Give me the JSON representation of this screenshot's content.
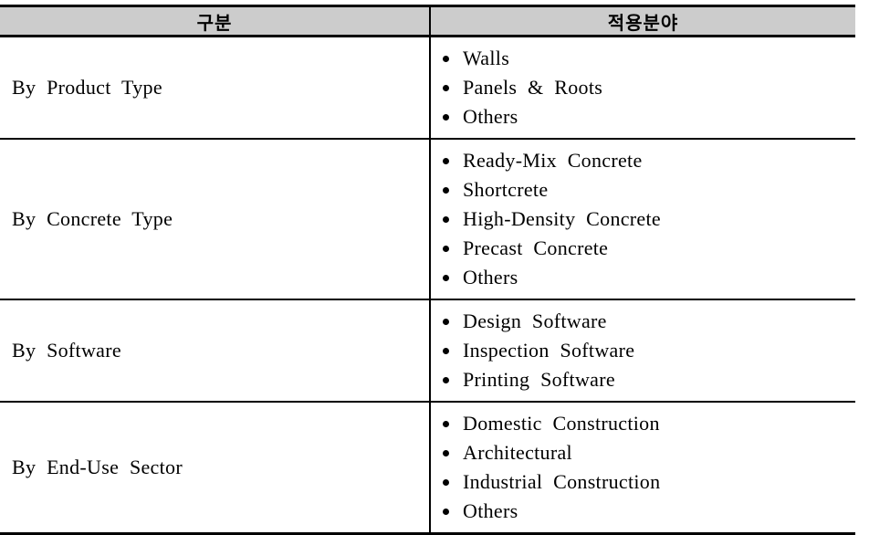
{
  "table": {
    "headers": {
      "category": "구분",
      "application": "적용분야"
    },
    "rows": [
      {
        "category": "By Product Type",
        "items": [
          "Walls",
          "Panels & Roots",
          "Others"
        ]
      },
      {
        "category": "By Concrete Type",
        "items": [
          "Ready-Mix Concrete",
          "Shortcrete",
          "High-Density Concrete",
          "Precast Concrete",
          "Others"
        ]
      },
      {
        "category": "By Software",
        "items": [
          "Design Software",
          "Inspection Software",
          "Printing Software"
        ]
      },
      {
        "category": "By End-Use Sector",
        "items": [
          "Domestic Construction",
          "Architectural",
          "Industrial Construction",
          "Others"
        ]
      }
    ]
  },
  "style": {
    "header_background": "#cccccc",
    "border_color": "#000000",
    "text_color": "#000000",
    "page_background": "#ffffff"
  }
}
